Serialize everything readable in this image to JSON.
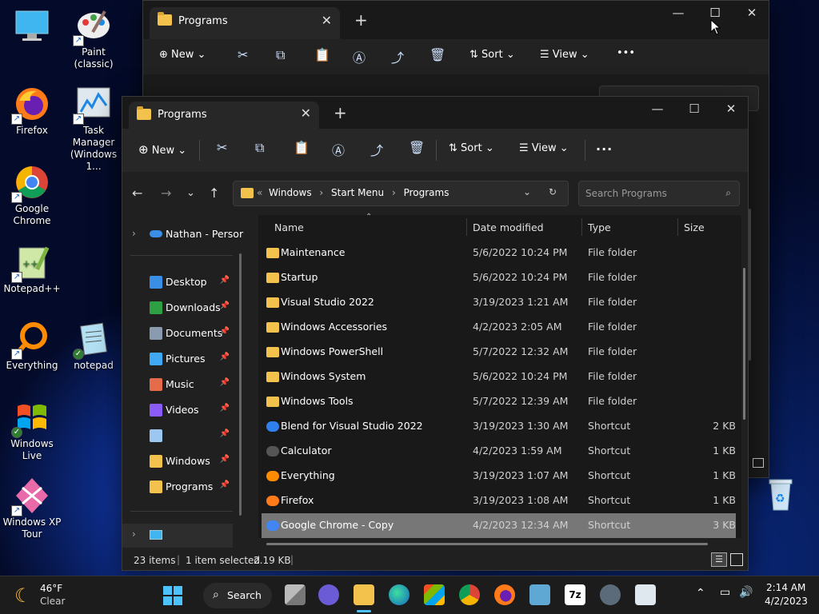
{
  "desktop": {
    "icons": [
      {
        "label": "",
        "icon": "monitor-icon"
      },
      {
        "label": "Paint (classic)",
        "icon": "paint-icon"
      },
      {
        "label": "Firefox",
        "icon": "firefox-icon"
      },
      {
        "label": "Task Manager (Windows 1...",
        "icon": "task-manager-icon"
      },
      {
        "label": "Google Chrome",
        "icon": "chrome-icon"
      },
      {
        "label": "Notepad++",
        "icon": "notepadpp-icon"
      },
      {
        "label": "Everything",
        "icon": "everything-icon"
      },
      {
        "label": "notepad",
        "icon": "notepad-icon"
      },
      {
        "label": "Windows Live",
        "icon": "windows-live-icon"
      },
      {
        "label": "Windows XP Tour",
        "icon": "xp-tour-icon"
      }
    ]
  },
  "back_window": {
    "tab_title": "Programs",
    "toolbar": {
      "new": "New",
      "sort": "Sort",
      "view": "View"
    },
    "breadcrumb": [
      "Windows",
      "Start Menu",
      "Programs"
    ],
    "search_placeholder": "Search Programs"
  },
  "window": {
    "tab_title": "Programs",
    "toolbar": {
      "new": "New",
      "sort": "Sort",
      "view": "View",
      "more": "..."
    },
    "breadcrumb_prefix": "«",
    "breadcrumb": [
      "Windows",
      "Start Menu",
      "Programs"
    ],
    "search_placeholder": "Search Programs",
    "nav_pane": {
      "top_item": "Nathan - Persor",
      "items": [
        {
          "label": "Desktop",
          "icon": "desktop-icon",
          "color": "#3a8ee6"
        },
        {
          "label": "Downloads",
          "icon": "downloads-icon",
          "color": "#2ea043"
        },
        {
          "label": "Documents",
          "icon": "documents-icon",
          "color": "#8a9bb0"
        },
        {
          "label": "Pictures",
          "icon": "pictures-icon",
          "color": "#3fa9f5"
        },
        {
          "label": "Music",
          "icon": "music-icon",
          "color": "#e66b4a"
        },
        {
          "label": "Videos",
          "icon": "videos-icon",
          "color": "#8b5cf6"
        },
        {
          "label": "",
          "icon": "recycle-icon",
          "color": "#9cc7f0"
        },
        {
          "label": "Windows",
          "icon": "folder-icon",
          "color": "#f3c24d"
        },
        {
          "label": "Programs",
          "icon": "folder-icon",
          "color": "#f3c24d"
        }
      ]
    },
    "columns": {
      "name": "Name",
      "date": "Date modified",
      "type": "Type",
      "size": "Size"
    },
    "files": [
      {
        "name": "Maintenance",
        "date": "5/6/2022 10:24 PM",
        "type": "File folder",
        "size": "",
        "icon": "folder-icon"
      },
      {
        "name": "Startup",
        "date": "5/6/2022 10:24 PM",
        "type": "File folder",
        "size": "",
        "icon": "folder-icon"
      },
      {
        "name": "Visual Studio 2022",
        "date": "3/19/2023 1:21 AM",
        "type": "File folder",
        "size": "",
        "icon": "folder-icon"
      },
      {
        "name": "Windows Accessories",
        "date": "4/2/2023 2:05 AM",
        "type": "File folder",
        "size": "",
        "icon": "folder-icon"
      },
      {
        "name": "Windows PowerShell",
        "date": "5/7/2022 12:32 AM",
        "type": "File folder",
        "size": "",
        "icon": "folder-icon"
      },
      {
        "name": "Windows System",
        "date": "5/6/2022 10:24 PM",
        "type": "File folder",
        "size": "",
        "icon": "folder-icon"
      },
      {
        "name": "Windows Tools",
        "date": "5/7/2022 12:39 AM",
        "type": "File folder",
        "size": "",
        "icon": "folder-icon"
      },
      {
        "name": "Blend for Visual Studio 2022",
        "date": "3/19/2023 1:30 AM",
        "type": "Shortcut",
        "size": "2 KB",
        "icon": "blend-icon"
      },
      {
        "name": "Calculator",
        "date": "4/2/2023 1:59 AM",
        "type": "Shortcut",
        "size": "1 KB",
        "icon": "calculator-icon"
      },
      {
        "name": "Everything",
        "date": "3/19/2023 1:07 AM",
        "type": "Shortcut",
        "size": "1 KB",
        "icon": "everything-icon"
      },
      {
        "name": "Firefox",
        "date": "3/19/2023 1:08 AM",
        "type": "Shortcut",
        "size": "1 KB",
        "icon": "firefox-icon"
      },
      {
        "name": "Google Chrome - Copy",
        "date": "4/2/2023 12:34 AM",
        "type": "Shortcut",
        "size": "3 KB",
        "icon": "chrome-icon",
        "selected": true
      }
    ],
    "status": {
      "items": "23 items",
      "selected": "1 item selected",
      "size": "2.19 KB"
    }
  },
  "taskbar": {
    "weather_temp": "46°F",
    "weather_desc": "Clear",
    "search": "Search",
    "time": "2:14 AM",
    "date": "4/2/2023"
  }
}
